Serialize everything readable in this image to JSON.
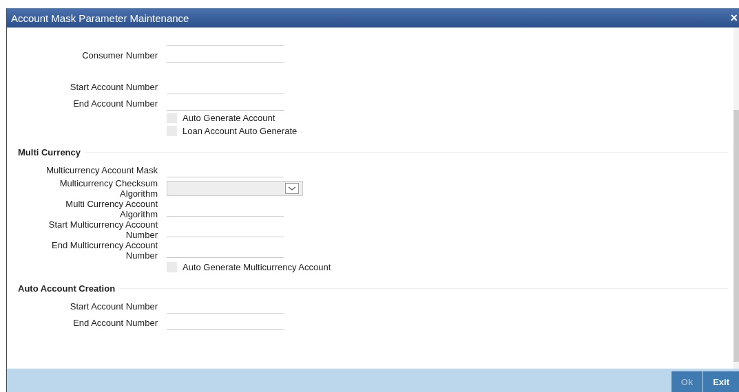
{
  "window": {
    "title": "Account Mask Parameter Maintenance",
    "close": "×"
  },
  "top_fields": [
    {
      "kind": "field"
    },
    {
      "kind": "field",
      "label": "Consumer Number"
    },
    {
      "kind": "spacer"
    },
    {
      "kind": "field",
      "label": "Start Account Number"
    },
    {
      "kind": "field",
      "label": "End Account Number"
    },
    {
      "kind": "checkbox",
      "label": "Auto Generate Account",
      "checked": false
    },
    {
      "kind": "checkbox",
      "label": "Loan Account Auto Generate",
      "checked": false
    }
  ],
  "sections": [
    {
      "title": "Multi Currency",
      "fields": [
        {
          "kind": "field",
          "label": "Multicurrency Account Mask"
        },
        {
          "kind": "select",
          "label": "Multicurrency Checksum Algorithm"
        },
        {
          "kind": "field",
          "label": "Multi Currency Account Algorithm"
        },
        {
          "kind": "field",
          "label": "Start Multicurrency Account Number"
        },
        {
          "kind": "field",
          "label": "End Multicurrency Account Number"
        },
        {
          "kind": "checkbox",
          "label": "Auto Generate Multicurrency Account",
          "checked": false
        }
      ]
    },
    {
      "title": "Auto Account Creation",
      "fields": [
        {
          "kind": "field",
          "label": "Start Account Number"
        },
        {
          "kind": "field",
          "label": "End Account Number"
        }
      ]
    }
  ],
  "buttons": [
    {
      "label": "Ok",
      "disabled": true
    },
    {
      "label": "Exit",
      "disabled": false
    }
  ]
}
